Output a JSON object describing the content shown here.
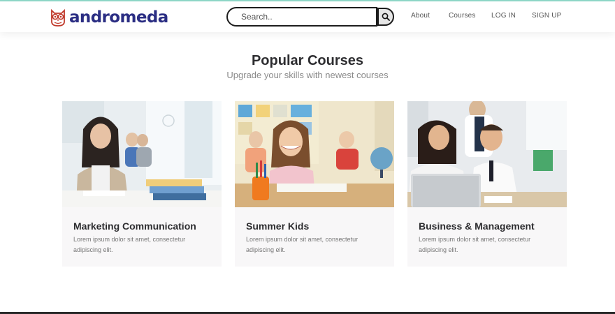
{
  "brand": {
    "name": "andromeda",
    "logo_icon": "owl-icon",
    "color": "#2b2e83",
    "icon_color": "#c0392b"
  },
  "search": {
    "placeholder": "Search..",
    "button_icon": "search-icon"
  },
  "nav": {
    "about": "About",
    "courses": "Courses",
    "login": "LOG IN",
    "signup": "SIGN UP"
  },
  "section": {
    "title": "Popular Courses",
    "subtitle": "Upgrade your skills with newest courses"
  },
  "courses": [
    {
      "title": "Marketing Communication",
      "description": "Lorem ipsum dolor sit amet, consectetur adipiscing elit.",
      "image": "student-writing-in-classroom"
    },
    {
      "title": "Summer Kids",
      "description": "Lorem ipsum dolor sit amet, consectetur adipiscing elit.",
      "image": "smiling-girl-at-desk"
    },
    {
      "title": "Business & Management",
      "description": "Lorem ipsum dolor sit amet, consectetur adipiscing elit.",
      "image": "business-people-with-laptop"
    }
  ]
}
